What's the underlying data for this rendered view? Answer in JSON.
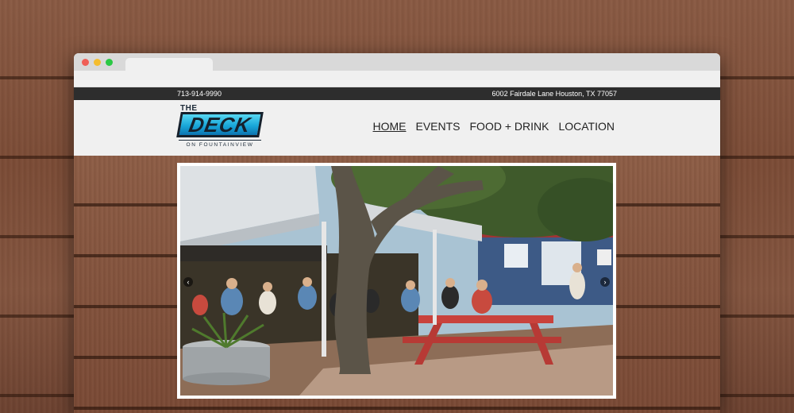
{
  "window": {
    "controls": [
      "close",
      "minimize",
      "maximize"
    ]
  },
  "topbar": {
    "phone": "713-914-9990",
    "address": "6002 Fairdale Lane Houston, TX 77057"
  },
  "logo": {
    "the": "THE",
    "name": "DECK",
    "subtitle": "ON FOUNTAINVIEW"
  },
  "nav": {
    "items": [
      {
        "label": "HOME",
        "active": true
      },
      {
        "label": "EVENTS",
        "active": false
      },
      {
        "label": "FOOD + DRINK",
        "active": false
      },
      {
        "label": "LOCATION",
        "active": false
      }
    ]
  },
  "slider": {
    "prev_icon": "chevron-left-icon",
    "next_icon": "chevron-right-icon",
    "prev_glyph": "‹",
    "next_glyph": "›"
  },
  "colors": {
    "topbar_bg": "#2d2d2d",
    "logo_blue": "#19a7d9",
    "header_bg": "#f0f0f0"
  }
}
